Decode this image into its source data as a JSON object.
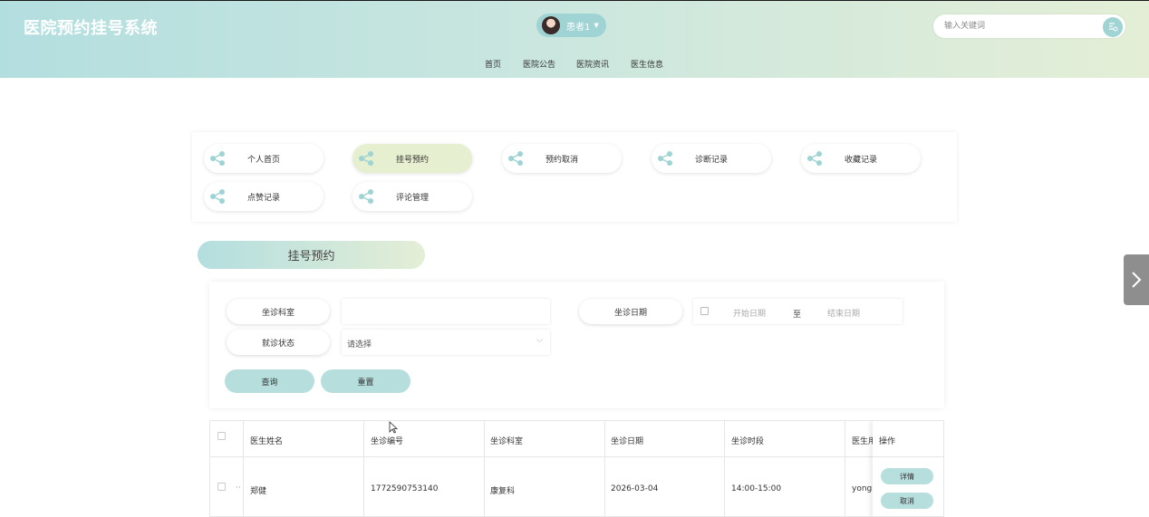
{
  "header": {
    "site_title": "医院预约挂号系统",
    "user_name": "患者1",
    "search_placeholder": "输入关键词",
    "nav": [
      {
        "label": "首页"
      },
      {
        "label": "医院公告"
      },
      {
        "label": "医院资讯"
      },
      {
        "label": "医生信息"
      }
    ]
  },
  "menu": [
    {
      "label": "个人首页",
      "active": false
    },
    {
      "label": "挂号预约",
      "active": true
    },
    {
      "label": "预约取消",
      "active": false
    },
    {
      "label": "诊断记录",
      "active": false
    },
    {
      "label": "收藏记录",
      "active": false
    },
    {
      "label": "点赞记录",
      "active": false
    },
    {
      "label": "评论管理",
      "active": false
    }
  ],
  "section_title": "挂号预约",
  "filters": {
    "dept_label": "坐诊科室",
    "dept_value": "",
    "date_label": "坐诊日期",
    "start_placeholder": "开始日期",
    "range_sep": "至",
    "end_placeholder": "结束日期",
    "status_label": "就诊状态",
    "status_value": "请选择",
    "query_button": "查询",
    "reset_button": "重置"
  },
  "table": {
    "columns": [
      "医生姓名",
      "坐诊编号",
      "坐诊科室",
      "坐诊日期",
      "坐诊时段",
      "医生用",
      "操作"
    ],
    "rows": [
      {
        "doctor_name": "郑健",
        "visit_no": "1772590753140",
        "dept": "康复科",
        "date": "2026-03-04",
        "time_slot": "14:00-15:00",
        "account": "yongh",
        "ellipsis": "··"
      }
    ],
    "detail_button": "详情",
    "cancel_button": "取消"
  },
  "colors": {
    "accent": "#b6dedd",
    "header_start": "#b3dedf",
    "header_end": "#e4eed6",
    "active_menu": "#e6efcf"
  }
}
